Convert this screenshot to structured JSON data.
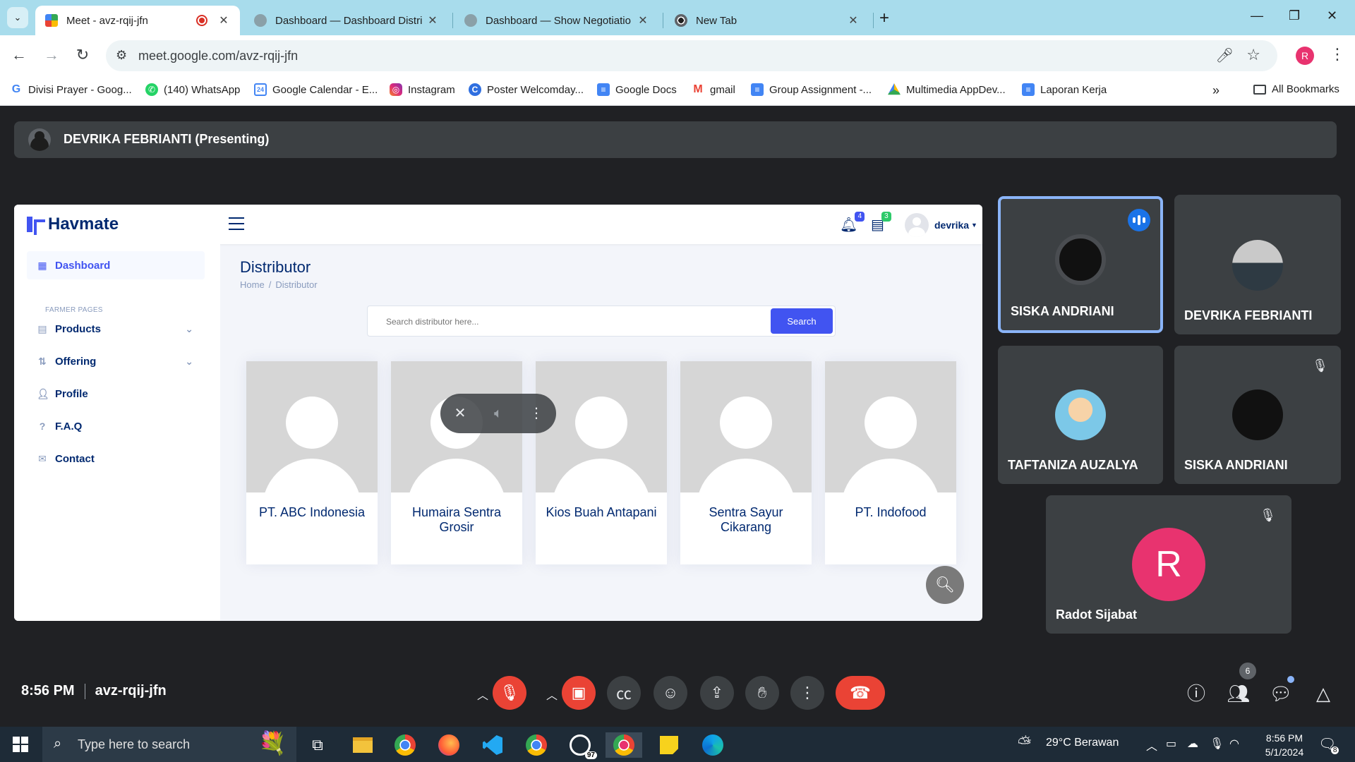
{
  "browser": {
    "tabs": [
      {
        "title": "Meet - avz-rqij-jfn",
        "active": true
      },
      {
        "title": "Dashboard — Dashboard Distri",
        "active": false
      },
      {
        "title": "Dashboard — Show Negotiatio",
        "active": false
      },
      {
        "title": "New Tab",
        "active": false
      }
    ],
    "url": "meet.google.com/avz-rqij-jfn",
    "profile_initial": "R",
    "bookmarks": [
      {
        "label": "Divisi Prayer - Goog...",
        "icon": "google-icon"
      },
      {
        "label": "(140) WhatsApp",
        "icon": "whatsapp-icon"
      },
      {
        "label": "Google Calendar - E...",
        "icon": "calendar-icon"
      },
      {
        "label": "Instagram",
        "icon": "instagram-icon"
      },
      {
        "label": "Poster Welcomday...",
        "icon": "canva-icon"
      },
      {
        "label": "Google Docs",
        "icon": "docs-icon"
      },
      {
        "label": "gmail",
        "icon": "gmail-icon"
      },
      {
        "label": "Group Assignment -...",
        "icon": "docs-icon"
      },
      {
        "label": "Multimedia AppDev...",
        "icon": "drive-icon"
      },
      {
        "label": "Laporan Kerja",
        "icon": "docs-icon"
      }
    ],
    "more_bookmarks": "»",
    "all_bookmarks": "All Bookmarks"
  },
  "meet": {
    "presenting_banner": "DEVRIKA FEBRIANTI (Presenting)",
    "time": "8:56 PM",
    "meeting_code": "avz-rqij-jfn",
    "participant_count": "6",
    "participants": [
      {
        "name": "SISKA ANDRIANI",
        "speaking": true,
        "muted": false
      },
      {
        "name": "DEVRIKA FEBRIANTI",
        "speaking": false,
        "muted": false
      },
      {
        "name": "TAFTANIZA AUZALYA",
        "speaking": false,
        "muted": false
      },
      {
        "name": "SISKA ANDRIANI",
        "speaking": false,
        "muted": true
      },
      {
        "name": "Radot Sijabat",
        "speaking": false,
        "muted": true,
        "initial": "R",
        "avatar_color": "#e8336f"
      }
    ]
  },
  "havmate": {
    "brand": "Havmate",
    "notifications_count": "4",
    "messages_count": "3",
    "user_name": "devrika",
    "sidebar": {
      "dashboard": "Dashboard",
      "section_heading": "FARMER PAGES",
      "items": [
        "Products",
        "Offering",
        "Profile",
        "F.A.Q",
        "Contact"
      ]
    },
    "page_title": "Distributor",
    "breadcrumb": [
      "Home",
      "Distributor"
    ],
    "search": {
      "placeholder": "Search distributor here...",
      "button": "Search"
    },
    "distributors": [
      "PT. ABC Indonesia",
      "Humaira Sentra Grosir",
      "Kios Buah Antapani",
      "Sentra Sayur Cikarang",
      "PT. Indofood"
    ],
    "accent_color": "#4154f1"
  },
  "taskbar": {
    "search_placeholder": "Type here to search",
    "whatsapp_badge": "97",
    "weather": "29°C  Berawan",
    "time": "8:56 PM",
    "date": "5/1/2024",
    "notification_badge": "8"
  }
}
